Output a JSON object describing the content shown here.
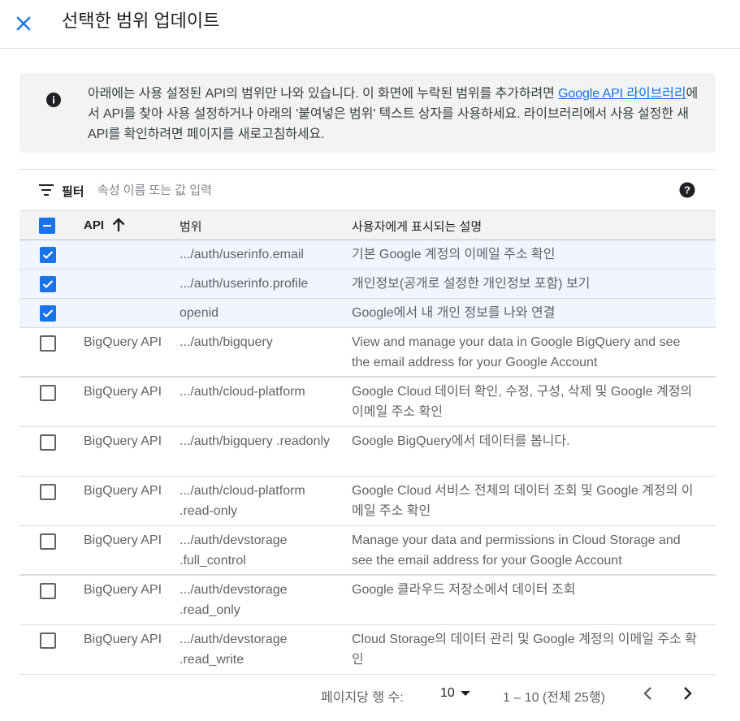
{
  "header": {
    "title": "선택한 범위 업데이트",
    "close_icon": "close-icon"
  },
  "info": {
    "icon": "info-icon",
    "text_before_link": "아래에는 사용 설정된 API의 범위만 나와 있습니다. 이 화면에 누락된 범위를 추가하려면 ",
    "link_text": "Google API 라이브러리",
    "text_after_link": "에서 API를 찾아 사용 설정하거나 아래의 '붙여넣은 범위' 텍스트 상자를 사용하세요. 라이브러리에서 사용 설정한 새 API를 확인하려면 페이지를 새로고침하세요."
  },
  "filter": {
    "label": "필터",
    "placeholder": "속성 이름 또는 값 입력",
    "filter_icon": "filter-icon",
    "help_icon": "help-icon"
  },
  "table": {
    "columns": {
      "api": "API",
      "scope": "범위",
      "description": "사용자에게 표시되는 설명"
    },
    "rows": [
      {
        "checked": true,
        "api": "",
        "scope": ".../auth/userinfo.email",
        "description": "기본 Google 계정의 이메일 주소 확인"
      },
      {
        "checked": true,
        "api": "",
        "scope": ".../auth/userinfo.profile",
        "description": "개인정보(공개로 설정한 개인정보 포함) 보기"
      },
      {
        "checked": true,
        "api": "",
        "scope": "openid",
        "description": "Google에서 내 개인 정보를 나와 연결"
      },
      {
        "checked": false,
        "api": "BigQuery API",
        "scope": ".../auth/bigquery",
        "description": "View and manage your data in Google BigQuery and see the email address for your Google Account"
      },
      {
        "checked": false,
        "api": "BigQuery API",
        "scope": ".../auth/cloud-platform",
        "description": "Google Cloud 데이터 확인, 수정, 구성, 삭제 및 Google 계정의 이메일 주소 확인"
      },
      {
        "checked": false,
        "api": "BigQuery API",
        "scope": ".../auth/bigquery .readonly",
        "description": "Google BigQuery에서 데이터를 봅니다."
      },
      {
        "checked": false,
        "api": "BigQuery API",
        "scope": ".../auth/cloud-platform .read-only",
        "description": "Google Cloud 서비스 전체의 데이터 조회 및 Google 계정의 이메일 주소 확인"
      },
      {
        "checked": false,
        "api": "BigQuery API",
        "scope": ".../auth/devstorage .full_control",
        "description": "Manage your data and permissions in Cloud Storage and see the email address for your Google Account"
      },
      {
        "checked": false,
        "api": "BigQuery API",
        "scope": ".../auth/devstorage .read_only",
        "description": "Google 클라우드 저장소에서 데이터 조회"
      },
      {
        "checked": false,
        "api": "BigQuery API",
        "scope": ".../auth/devstorage .read_write",
        "description": "Cloud Storage의 데이터 관리 및 Google 계정의 이메일 주소 확인"
      }
    ]
  },
  "pager": {
    "rows_per_page_label": "페이지당 행 수:",
    "rows_per_page": "10",
    "range": "1 – 10 (전체 25행)"
  },
  "colors": {
    "accent": "#1a73e8",
    "selected_row_bg": "#f0f5fe",
    "header_bg": "#f1f3f4"
  }
}
